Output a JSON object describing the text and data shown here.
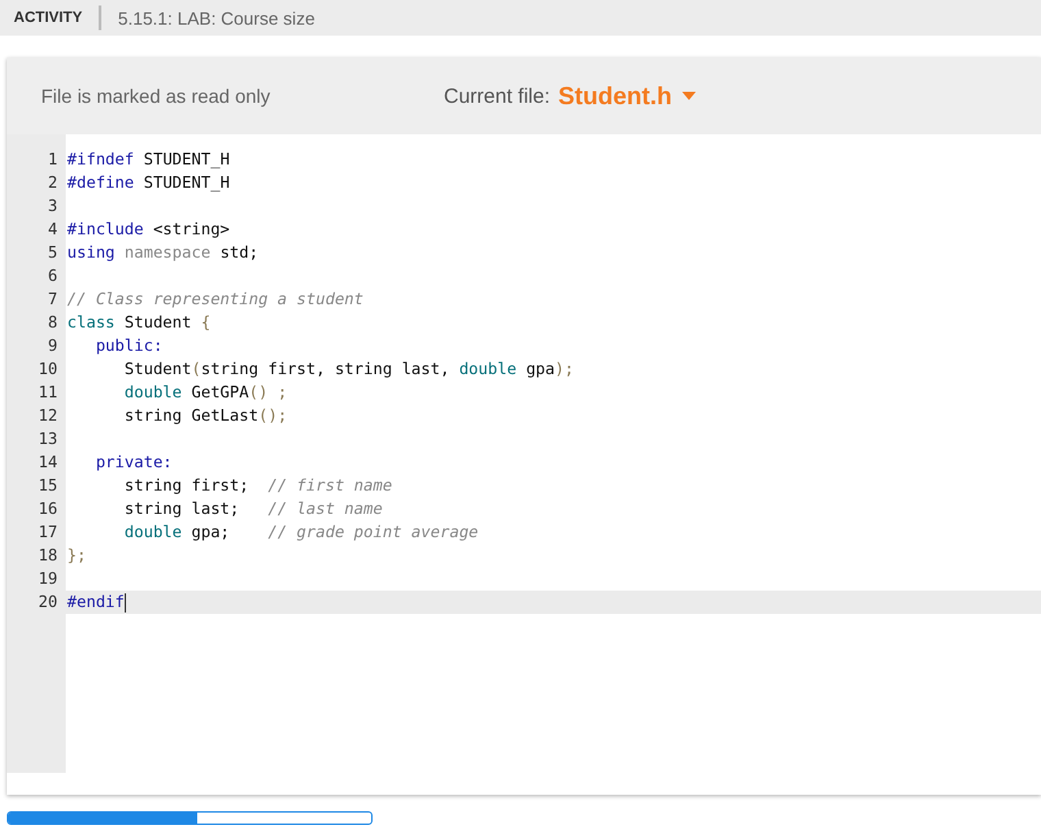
{
  "header": {
    "label": "ACTIVITY",
    "title": "5.15.1: LAB: Course size"
  },
  "toolbar": {
    "status": "File is marked as read only",
    "current_file_label": "Current file:",
    "current_file": "Student.h"
  },
  "editor": {
    "lines": [
      {
        "number": "1",
        "active": false,
        "tokens": [
          {
            "kind": "directive",
            "text": "#ifndef"
          },
          {
            "kind": "plain",
            "text": " STUDENT_H"
          }
        ]
      },
      {
        "number": "2",
        "active": false,
        "tokens": [
          {
            "kind": "directive",
            "text": "#define"
          },
          {
            "kind": "plain",
            "text": " STUDENT_H"
          }
        ]
      },
      {
        "number": "3",
        "active": false
      },
      {
        "number": "4",
        "active": false,
        "tokens": [
          {
            "kind": "directive",
            "text": "#include"
          },
          {
            "kind": "plain",
            "text": " <string>"
          }
        ]
      },
      {
        "number": "5",
        "active": false,
        "tokens": [
          {
            "kind": "directive",
            "text": "using"
          },
          {
            "kind": "dim",
            "text": " namespace"
          },
          {
            "kind": "plain",
            "text": " std;"
          }
        ]
      },
      {
        "number": "6",
        "active": false
      },
      {
        "number": "7",
        "active": false,
        "tokens": [
          {
            "kind": "comment",
            "text": "// Class representing a student"
          }
        ]
      },
      {
        "number": "8",
        "active": false,
        "tokens": [
          {
            "kind": "type",
            "text": "class"
          },
          {
            "kind": "plain",
            "text": " Student "
          },
          {
            "kind": "punct",
            "text": "{"
          }
        ]
      },
      {
        "number": "9",
        "active": false,
        "tokens": [
          {
            "kind": "directive",
            "text": "   public:"
          }
        ]
      },
      {
        "number": "10",
        "active": false,
        "tokens": [
          {
            "kind": "plain",
            "text": "      Student"
          },
          {
            "kind": "punct",
            "text": "("
          },
          {
            "kind": "plain",
            "text": "string first, string last, "
          },
          {
            "kind": "type",
            "text": "double"
          },
          {
            "kind": "plain",
            "text": " gpa"
          },
          {
            "kind": "punct",
            "text": ");"
          }
        ]
      },
      {
        "number": "11",
        "active": false,
        "tokens": [
          {
            "kind": "type",
            "text": "      double"
          },
          {
            "kind": "plain",
            "text": " GetGPA"
          },
          {
            "kind": "punct",
            "text": "() ;"
          }
        ]
      },
      {
        "number": "12",
        "active": false,
        "tokens": [
          {
            "kind": "plain",
            "text": "      string GetLast"
          },
          {
            "kind": "punct",
            "text": "();"
          }
        ]
      },
      {
        "number": "13",
        "active": false
      },
      {
        "number": "14",
        "active": false,
        "tokens": [
          {
            "kind": "directive",
            "text": "   private:"
          }
        ]
      },
      {
        "number": "15",
        "active": false,
        "tokens": [
          {
            "kind": "plain",
            "text": "      string first;  "
          },
          {
            "kind": "comment",
            "text": "// first name"
          }
        ]
      },
      {
        "number": "16",
        "active": false,
        "tokens": [
          {
            "kind": "plain",
            "text": "      string last;   "
          },
          {
            "kind": "comment",
            "text": "// last name"
          }
        ]
      },
      {
        "number": "17",
        "active": false,
        "tokens": [
          {
            "kind": "type",
            "text": "      double"
          },
          {
            "kind": "plain",
            "text": " gpa;    "
          },
          {
            "kind": "comment",
            "text": "// grade point average"
          }
        ]
      },
      {
        "number": "18",
        "active": false,
        "tokens": [
          {
            "kind": "punct",
            "text": "};"
          }
        ]
      },
      {
        "number": "19",
        "active": false
      },
      {
        "number": "20",
        "active": true,
        "tokens": [
          {
            "kind": "directive",
            "text": "#endif"
          }
        ]
      }
    ]
  },
  "progress": {
    "level": 0.52
  }
}
